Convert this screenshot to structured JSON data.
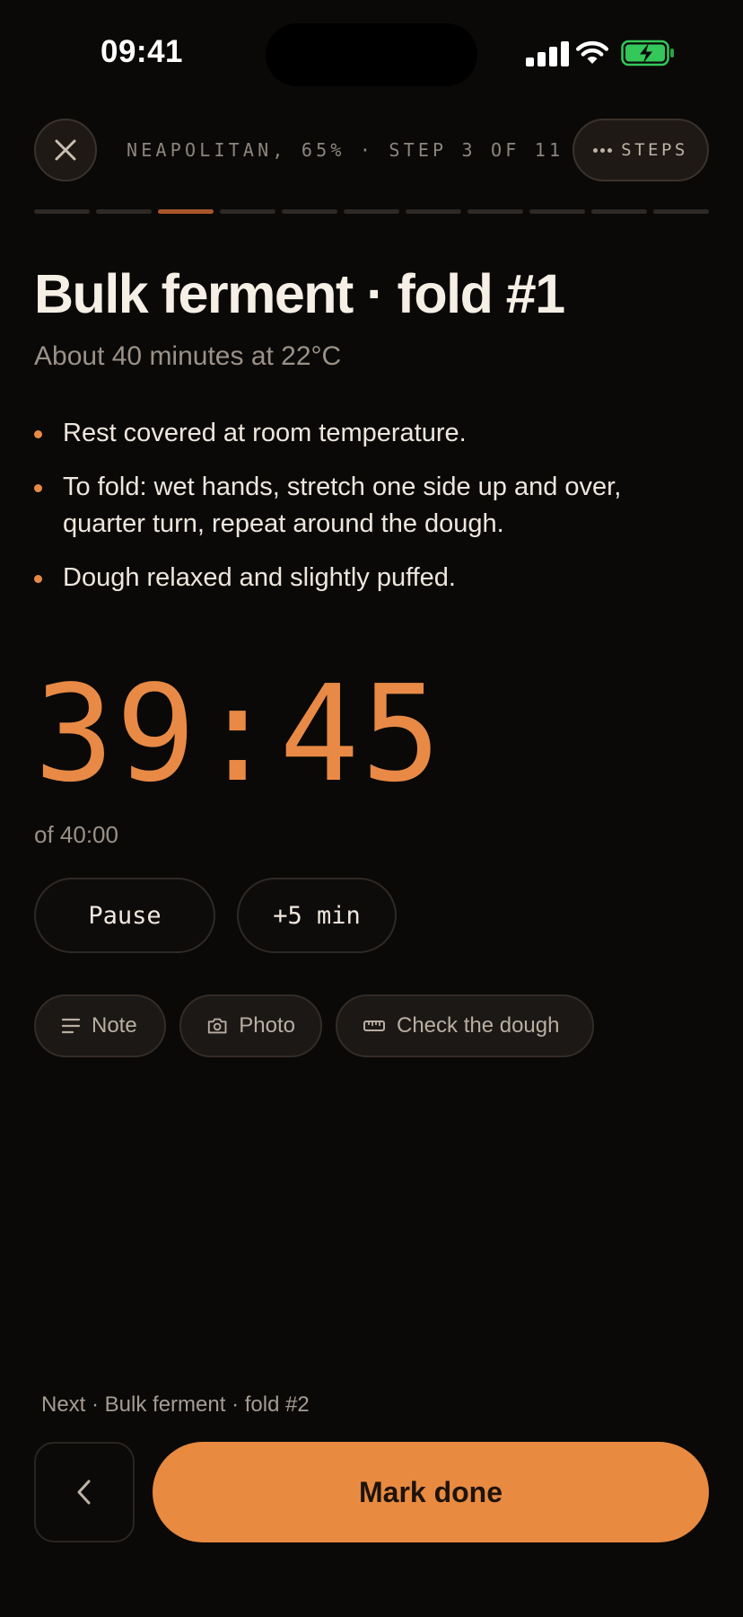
{
  "status_bar": {
    "time": "09:41"
  },
  "header": {
    "breadcrumb": "NEAPOLITAN, 65% · STEP 3 OF 11",
    "steps_label": "STEPS",
    "current_step": 3,
    "total_steps": 11
  },
  "step": {
    "title": "Bulk ferment · fold #1",
    "subtitle": "About 40 minutes at 22°C",
    "instructions": [
      "Rest covered at room temperature.",
      "To fold: wet hands, stretch one side up and over, quarter turn, repeat around the dough.",
      "Dough relaxed and slightly puffed."
    ]
  },
  "timer": {
    "remaining": "39:45",
    "total_label": "of 40:00"
  },
  "controls": {
    "pause_label": "Pause",
    "add_time_label": "+5 min"
  },
  "chips": {
    "note_label": "Note",
    "photo_label": "Photo",
    "check_label": "Check the dough"
  },
  "footer": {
    "next_label": "Next · Bulk ferment · fold #2",
    "done_label": "Mark done"
  },
  "colors": {
    "accent": "#e88a40",
    "background": "#0a0908",
    "battery_green": "#34c759"
  },
  "icons": {
    "close": "close-icon",
    "steps": "more-dots-icon",
    "note": "lines-icon",
    "photo": "camera-icon",
    "check": "ruler-icon",
    "back": "chevron-left-icon"
  }
}
